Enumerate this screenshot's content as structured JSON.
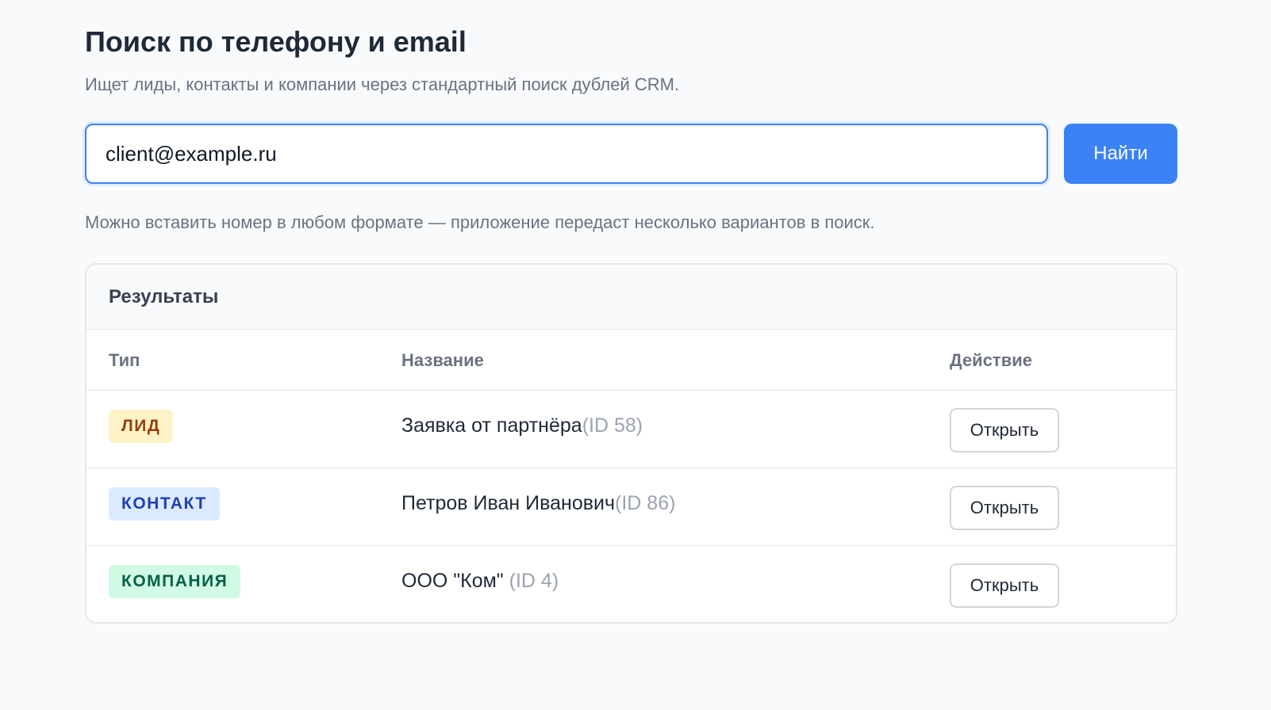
{
  "page": {
    "title": "Поиск по телефону и email",
    "subtitle": "Ищет лиды, контакты и компании через стандартный поиск дублей CRM.",
    "hint": "Можно вставить номер в любом формате — приложение передаст несколько вариантов в поиск."
  },
  "search": {
    "value": "client@example.ru",
    "button_label": "Найти"
  },
  "results": {
    "title": "Результаты",
    "columns": [
      "Тип",
      "Название",
      "Действие"
    ],
    "rows": [
      {
        "type": "ЛИД",
        "name": "Заявка от партнёра",
        "id_text": "(ID 58)",
        "action": "Открыть"
      },
      {
        "type": "КОНТАКТ",
        "name": "Петров Иван Иванович",
        "id_text": "(ID 86)",
        "action": "Открыть"
      },
      {
        "type": "КОМПАНИЯ",
        "name": "ООО \"Ком\" ",
        "id_text": "(ID 4)",
        "action": "Открыть"
      }
    ]
  },
  "colors": {
    "accent": "#3b82f6",
    "badge_lead_bg": "#fef3c7",
    "badge_lead_fg": "#92400e",
    "badge_contact_bg": "#dbeafe",
    "badge_contact_fg": "#1e40af",
    "badge_company_bg": "#d1fae5",
    "badge_company_fg": "#065f46"
  }
}
